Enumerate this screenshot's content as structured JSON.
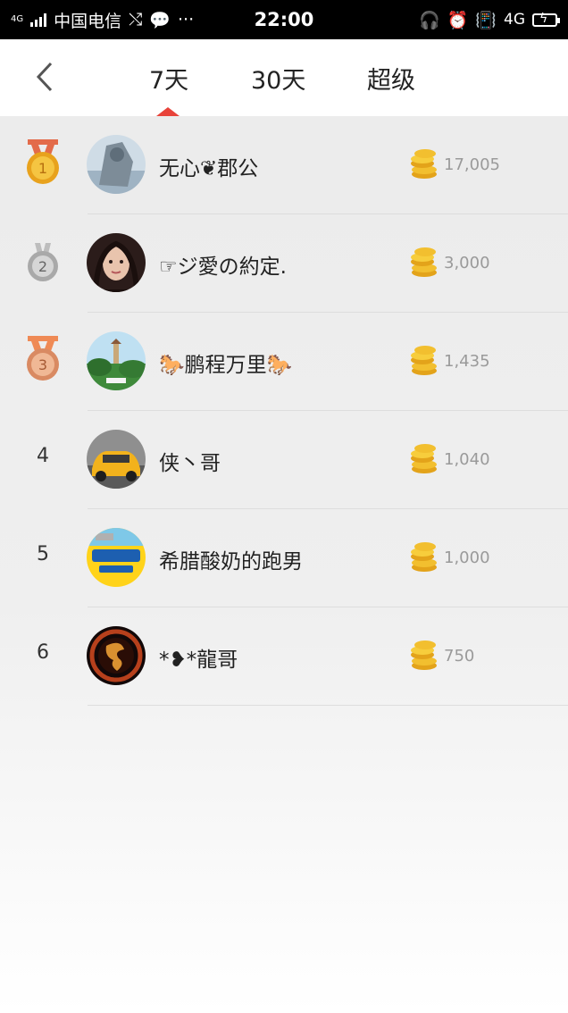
{
  "status_bar": {
    "net_small": "4G",
    "carrier": "中国电信",
    "more": "···",
    "time": "22:00",
    "network": "4G"
  },
  "header": {
    "tabs": [
      "7天",
      "30天",
      "超级"
    ],
    "active_tab": "7天"
  },
  "colors": {
    "accent": "#e8433a",
    "gold": "#f5b82e",
    "silver": "#bdbdbd",
    "bronze": "#e0a17c"
  },
  "ranking": [
    {
      "rank": "1",
      "medal": "gold",
      "name": "无心❦郡公",
      "score": "17,005"
    },
    {
      "rank": "2",
      "medal": "silver",
      "name": "☞ジ愛の約定.",
      "score": "3,000"
    },
    {
      "rank": "3",
      "medal": "bronze",
      "name": "🐎鹏程万里🐎",
      "score": "1,435"
    },
    {
      "rank": "4",
      "medal": "",
      "name": "侠丶哥",
      "score": "1,040"
    },
    {
      "rank": "5",
      "medal": "",
      "name": "希腊酸奶的跑男",
      "score": "1,000"
    },
    {
      "rank": "6",
      "medal": "",
      "name": "*❥*龍哥",
      "score": "750"
    }
  ]
}
